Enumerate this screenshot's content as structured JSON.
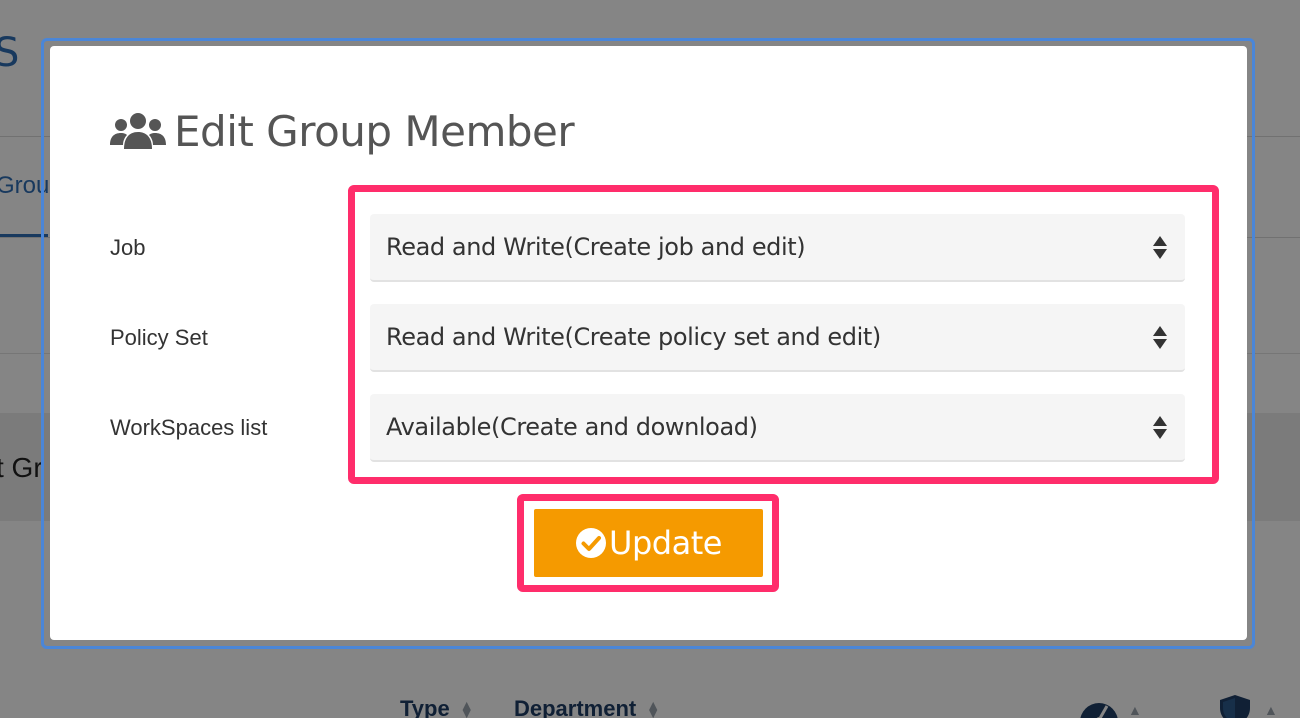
{
  "background": {
    "header_fragment": "S",
    "tab_fragment": "Grou",
    "section_fragment": "t Gr",
    "table_columns": [
      "Type",
      "Department"
    ]
  },
  "modal": {
    "title": "Edit Group Member",
    "title_icon": "users-icon",
    "fields": [
      {
        "label": "Job",
        "value": "Read and Write(Create job and edit)"
      },
      {
        "label": "Policy Set",
        "value": "Read and Write(Create policy set and edit)"
      },
      {
        "label": "WorkSpaces list",
        "value": "Available(Create and download)"
      }
    ],
    "update_button": {
      "label": "Update",
      "icon": "check-circle-icon"
    }
  },
  "colors": {
    "accent_orange": "#f59a00",
    "highlight_pink": "#ff2d6b",
    "focus_blue": "#4a86d8",
    "brand_blue": "#2f6db5"
  }
}
